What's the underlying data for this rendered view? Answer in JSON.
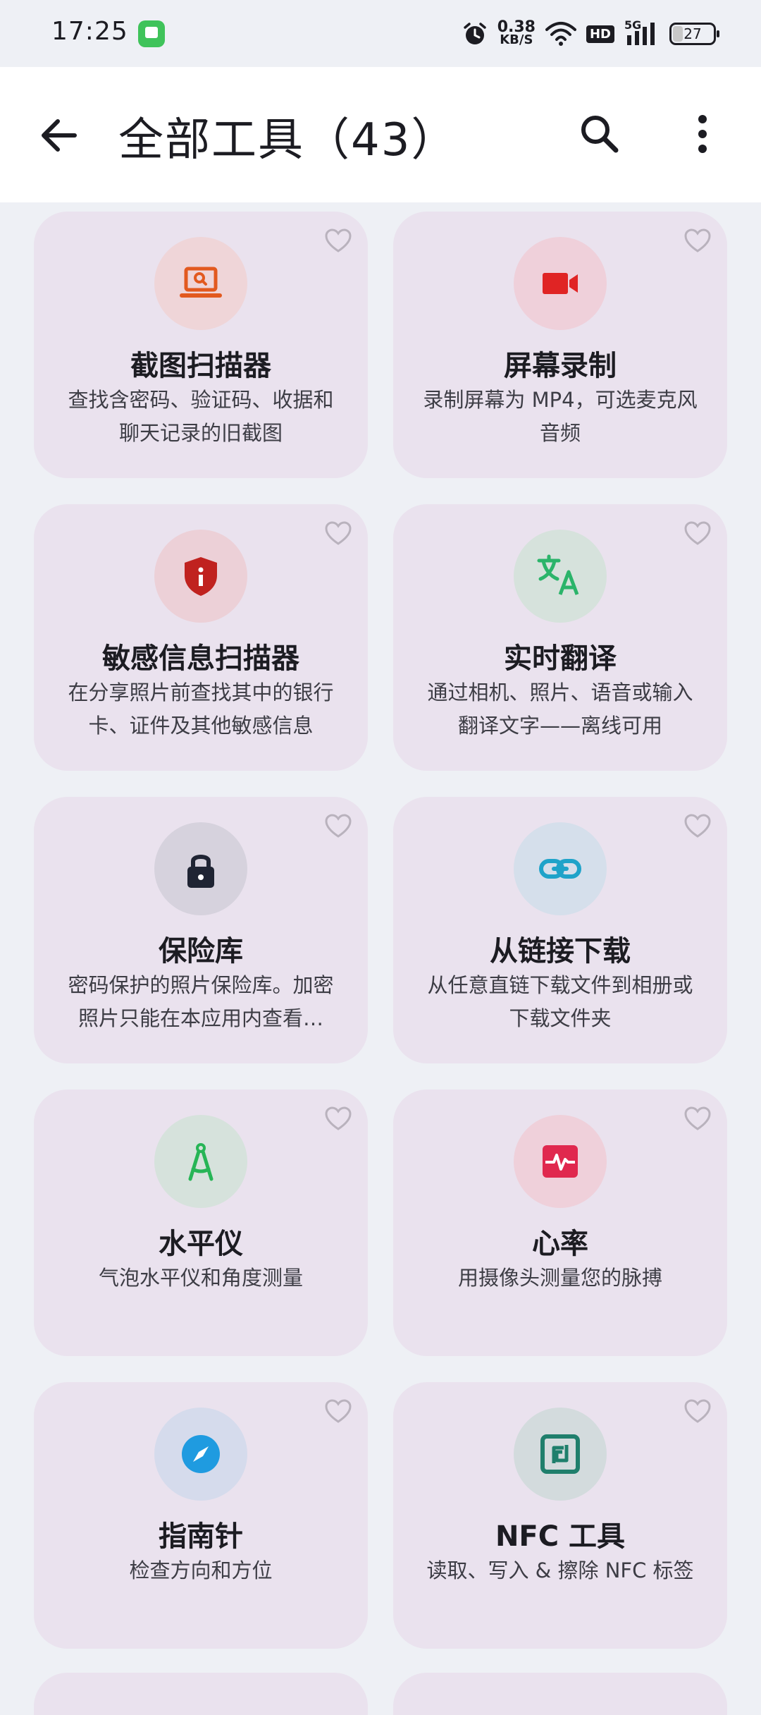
{
  "status_bar": {
    "time": "17:25",
    "net_speed_value": "0.38",
    "net_speed_unit": "KB/S",
    "hd": "HD",
    "signal": "5G",
    "battery": "27"
  },
  "header": {
    "title": "全部工具（43）"
  },
  "tools": [
    {
      "title": "截图扫描器",
      "desc": "查找含密码、验证码、收据和聊天记录的旧截图",
      "icon": "laptop-search-icon",
      "color": "#e2591f",
      "bg": "#efd5d8"
    },
    {
      "title": "屏幕录制",
      "desc": "录制屏幕为 MP4，可选麦克风音频",
      "icon": "video-camera-icon",
      "color": "#e02424",
      "bg": "#efd0da"
    },
    {
      "title": "敏感信息扫描器",
      "desc": "在分享照片前查找其中的银行卡、证件及其他敏感信息",
      "icon": "shield-info-icon",
      "color": "#c0221f",
      "bg": "#ecd0d7"
    },
    {
      "title": "实时翻译",
      "desc": "通过相机、照片、语音或输入翻译文字——离线可用",
      "icon": "translate-icon",
      "color": "#2bb46a",
      "bg": "#d6e2dc"
    },
    {
      "title": "保险库",
      "desc": "密码保护的照片保险库。加密照片只能在本应用内查看…",
      "icon": "lock-icon",
      "color": "#1f2433",
      "bg": "#d6d2dd"
    },
    {
      "title": "从链接下载",
      "desc": "从任意直链下载文件到相册或下载文件夹",
      "icon": "link-icon",
      "color": "#1fa3c9",
      "bg": "#d5dfeb"
    },
    {
      "title": "水平仪",
      "desc": "气泡水平仪和角度测量",
      "icon": "compass-tool-icon",
      "color": "#27b556",
      "bg": "#d6e2dc"
    },
    {
      "title": "心率",
      "desc": "用摄像头测量您的脉搏",
      "icon": "heart-rate-icon",
      "color": "#e0284e",
      "bg": "#efd0da"
    },
    {
      "title": "指南针",
      "desc": "检查方向和方位",
      "icon": "compass-icon",
      "color": "#1f9be0",
      "bg": "#d5dbec"
    },
    {
      "title": "NFC 工具",
      "desc": "读取、写入 & 擦除 NFC 标签",
      "icon": "nfc-icon",
      "color": "#1f7f6c",
      "bg": "#d3dbdd"
    }
  ]
}
